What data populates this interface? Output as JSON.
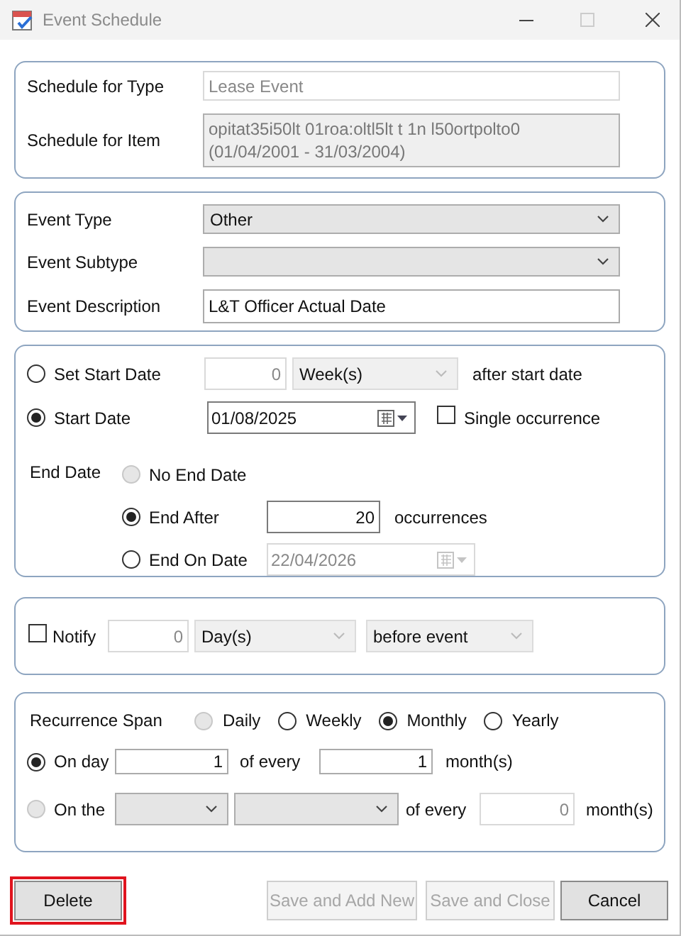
{
  "window": {
    "title": "Event Schedule"
  },
  "schedule": {
    "type_label": "Schedule for Type",
    "type_value": "Lease Event",
    "item_label": "Schedule for Item",
    "item_value_lines": [
      "opitat35i50lt 01roa:oltl5lt t 1n l50ortpolto0",
      "(01/04/2001 - 31/03/2004)"
    ]
  },
  "event": {
    "type": {
      "label": "Event Type",
      "value": "Other"
    },
    "subtype": {
      "label": "Event Subtype"
    },
    "description": {
      "label": "Event Description",
      "value": "L&T Officer Actual Date"
    }
  },
  "start": {
    "set_start": {
      "label": "Set Start Date",
      "selected": false,
      "amount": "0",
      "unit": "Week(s)",
      "unit_disabled": true,
      "suffix": "after start date"
    },
    "start_date": {
      "label": "Start Date",
      "selected": true,
      "value": "01/08/2025"
    },
    "single_occurrence": {
      "label": "Single occurrence",
      "checked": false
    }
  },
  "end": {
    "label": "End Date",
    "options": [
      {
        "kind": "plain",
        "label": "No End Date",
        "selected": false,
        "disabled": true
      },
      {
        "kind": "count",
        "label": "End After",
        "selected": true,
        "disabled": false,
        "value": "20",
        "suffix": "occurrences"
      },
      {
        "kind": "date",
        "label": "End On Date",
        "selected": false,
        "disabled": false,
        "value": "22/04/2026",
        "field_disabled": true
      }
    ]
  },
  "notify": {
    "label": "Notify",
    "checked": false,
    "amount": "0",
    "unit": "Day(s)",
    "timing": "before event",
    "disabled": true
  },
  "recurrence": {
    "label": "Recurrence Span",
    "spans": [
      {
        "label": "Daily",
        "selected": false,
        "disabled": true
      },
      {
        "label": "Weekly",
        "selected": false,
        "disabled": false
      },
      {
        "label": "Monthly",
        "selected": true,
        "disabled": false
      },
      {
        "label": "Yearly",
        "selected": false,
        "disabled": false
      }
    ],
    "on_day": {
      "label": "On day",
      "selected": true,
      "disabled": false,
      "day": "1",
      "of_every": "of every",
      "months": "1",
      "unit": "month(s)"
    },
    "on_the": {
      "label": "On the",
      "selected": false,
      "disabled": true,
      "of_every": "of every",
      "months": "0",
      "unit": "month(s)"
    }
  },
  "buttons": [
    {
      "label": "Delete",
      "disabled": false,
      "highlighted": true
    },
    {
      "label": "Save and Add New",
      "disabled": true,
      "highlighted": false
    },
    {
      "label": "Save and Close",
      "disabled": true,
      "highlighted": false
    },
    {
      "label": "Cancel",
      "disabled": false,
      "highlighted": false
    }
  ]
}
